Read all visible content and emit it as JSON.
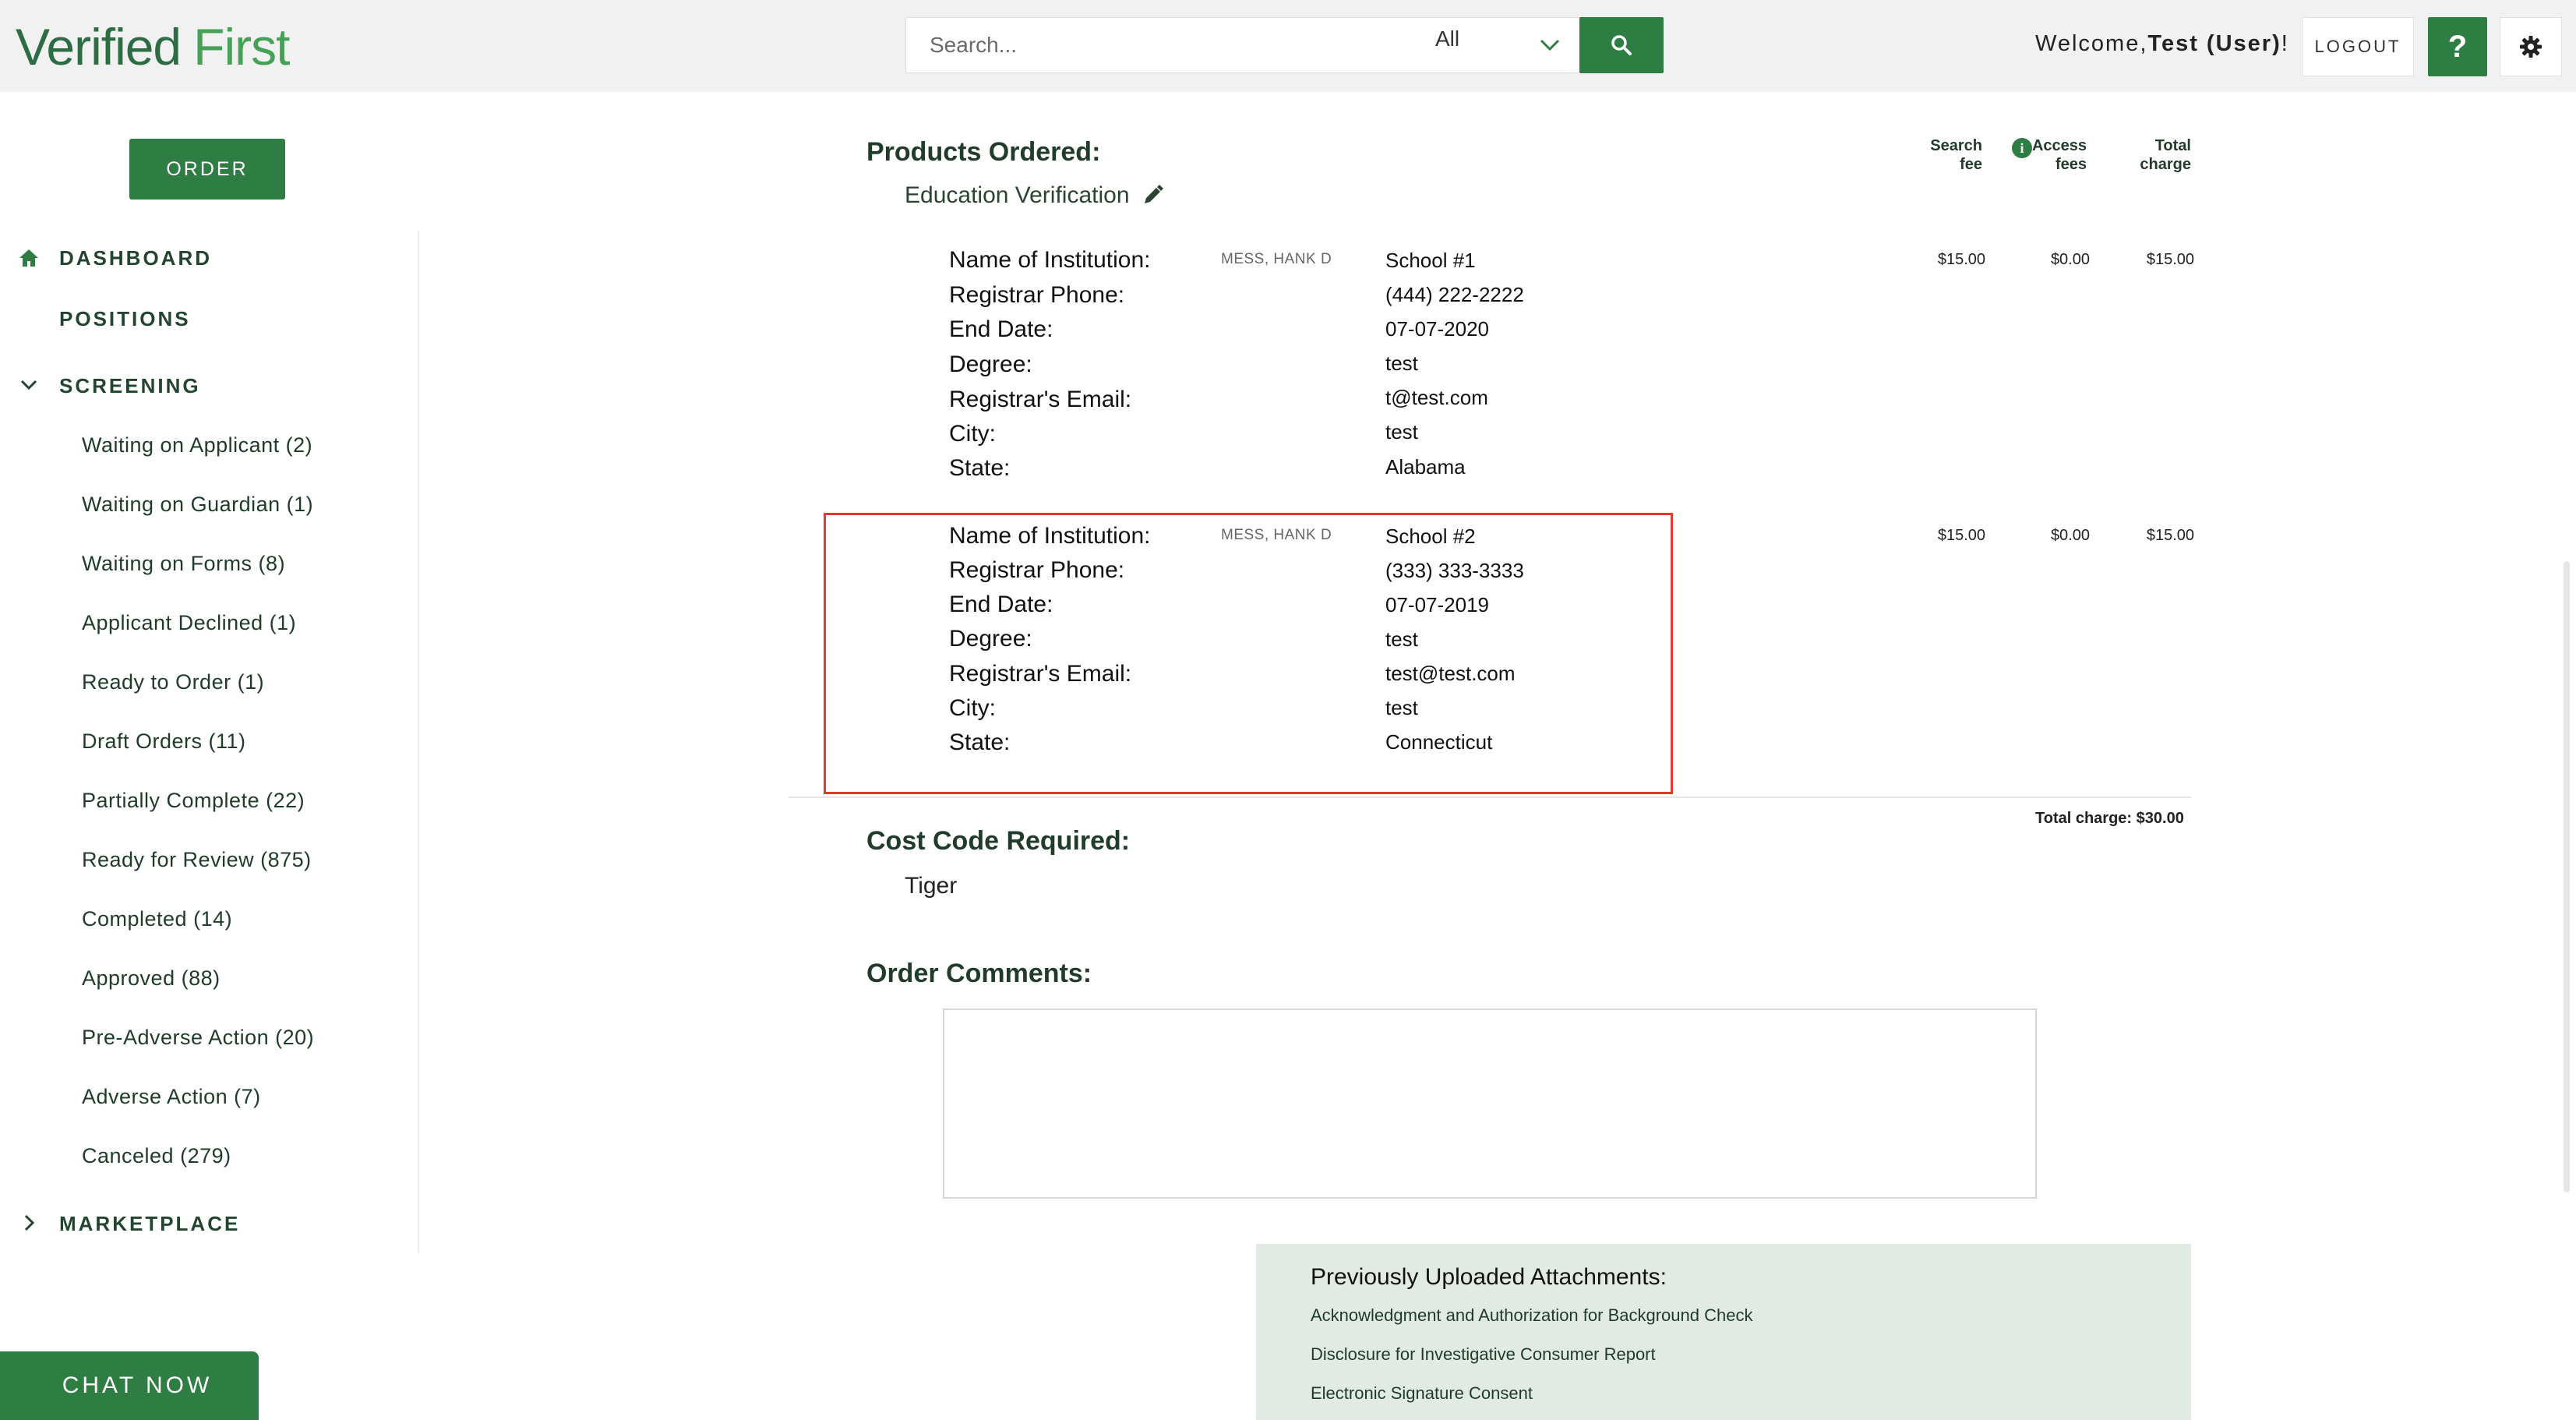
{
  "header": {
    "logo_part1": "Verified",
    "logo_part2": "First",
    "search_placeholder": "Search...",
    "search_scope": "All",
    "welcome_prefix": "Welcome,",
    "welcome_user": "Test (User)",
    "welcome_suffix": "!",
    "logout_label": "LOGOUT",
    "help_label": "?"
  },
  "sidebar": {
    "order_label": "ORDER",
    "dashboard_label": "DASHBOARD",
    "positions_label": "POSITIONS",
    "screening_label": "SCREENING",
    "marketplace_label": "MARKETPLACE",
    "screening_items": [
      "Waiting on Applicant (2)",
      "Waiting on Guardian (1)",
      "Waiting on Forms (8)",
      "Applicant Declined (1)",
      "Ready to Order (1)",
      "Draft Orders (11)",
      "Partially Complete (22)",
      "Ready for Review (875)",
      "Completed (14)",
      "Approved (88)",
      "Pre-Adverse Action (20)",
      "Adverse Action (7)",
      "Canceled (279)"
    ]
  },
  "main": {
    "products_title": "Products Ordered:",
    "product_name": "Education Verification",
    "columns": {
      "search_fee_1": "Search",
      "search_fee_2": "fee",
      "access_fees_1": "Access",
      "access_fees_2": "fees",
      "total_charge_1": "Total",
      "total_charge_2": "charge"
    },
    "labels": {
      "institution": "Name of Institution:",
      "phone": "Registrar Phone:",
      "end_date": "End Date:",
      "degree": "Degree:",
      "email": "Registrar's Email:",
      "city": "City:",
      "state": "State:"
    },
    "records": [
      {
        "applicant": "MESS, HANK D",
        "institution": "School #1",
        "phone": "(444) 222-2222",
        "end_date": "07-07-2020",
        "degree": "test",
        "email": "t@test.com",
        "city": "test",
        "state": "Alabama",
        "search_fee": "$15.00",
        "access_fee": "$0.00",
        "total": "$15.00"
      },
      {
        "applicant": "MESS, HANK D",
        "institution": "School #2",
        "phone": "(333) 333-3333",
        "end_date": "07-07-2019",
        "degree": "test",
        "email": "test@test.com",
        "city": "test",
        "state": "Connecticut",
        "search_fee": "$15.00",
        "access_fee": "$0.00",
        "total": "$15.00"
      }
    ],
    "total_charge": "Total charge: $30.00",
    "cost_code_title": "Cost Code Required:",
    "cost_code_value": "Tiger",
    "comments_title": "Order Comments:",
    "comments_value": "",
    "attachments_title": "Previously Uploaded Attachments:",
    "attachments": [
      "Acknowledgment and Authorization for Background Check",
      "Disclosure for Investigative Consumer Report",
      "Electronic Signature Consent"
    ]
  },
  "chat_label": "CHAT NOW",
  "colors": {
    "brand_green": "#2e7d43",
    "highlight_red": "#e03a2a",
    "attachment_bg": "#e2ebe3"
  }
}
